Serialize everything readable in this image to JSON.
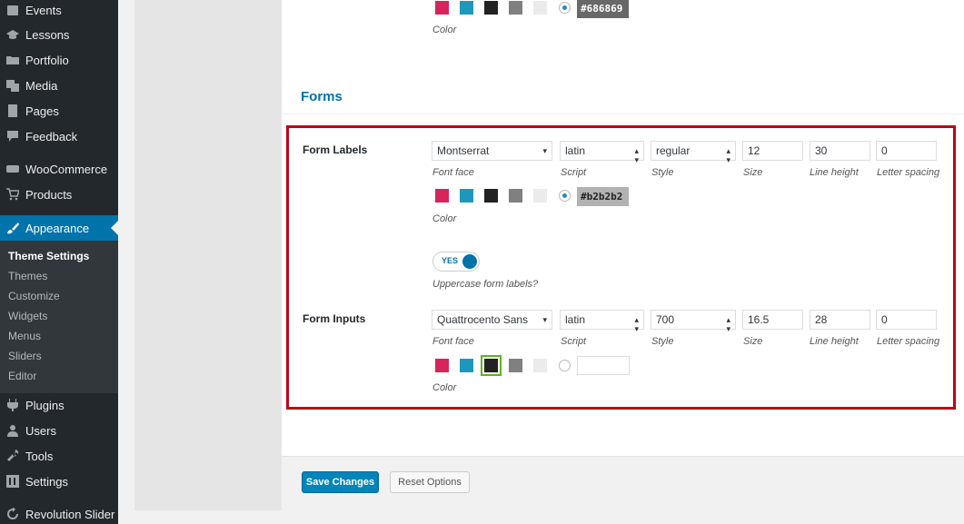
{
  "sidebar": {
    "items": [
      {
        "label": "Events",
        "icon": "calendar-icon"
      },
      {
        "label": "Lessons",
        "icon": "graduation-cap-icon"
      },
      {
        "label": "Portfolio",
        "icon": "folder-icon"
      },
      {
        "label": "Media",
        "icon": "media-icon"
      },
      {
        "label": "Pages",
        "icon": "page-icon"
      },
      {
        "label": "Feedback",
        "icon": "comment-icon"
      },
      {
        "label": "WooCommerce",
        "icon": "woocommerce-icon"
      },
      {
        "label": "Products",
        "icon": "cart-icon"
      },
      {
        "label": "Appearance",
        "icon": "paintbrush-icon"
      },
      {
        "label": "Plugins",
        "icon": "plugin-icon"
      },
      {
        "label": "Users",
        "icon": "user-icon"
      },
      {
        "label": "Tools",
        "icon": "wrench-icon"
      },
      {
        "label": "Settings",
        "icon": "settings-icon"
      },
      {
        "label": "Revolution Slider",
        "icon": "refresh-icon"
      }
    ],
    "submenu": [
      "Theme Settings",
      "Themes",
      "Customize",
      "Widgets",
      "Menus",
      "Sliders",
      "Editor"
    ]
  },
  "top_row": {
    "hex_value": "#686869",
    "color_label": "Color"
  },
  "section": {
    "title": "Forms"
  },
  "form_labels": {
    "label": "Form Labels",
    "font_face": "Montserrat",
    "script": "latin",
    "style": "regular",
    "size": "12",
    "line_height": "30",
    "letter_spacing": "0",
    "hex_value": "#b2b2b2",
    "toggle_text": "YES",
    "toggle_caption": "Uppercase form labels?"
  },
  "form_inputs": {
    "label": "Form Inputs",
    "font_face": "Quattrocento Sans",
    "script": "latin",
    "style": "700",
    "size": "16.5",
    "line_height": "28",
    "letter_spacing": "0",
    "hex_value": ""
  },
  "field_captions": {
    "font_face": "Font face",
    "script": "Script",
    "style": "Style",
    "size": "Size",
    "line_height": "Line height",
    "letter_spacing": "Letter spacing",
    "color": "Color"
  },
  "swatch_colors": [
    "#d6245d",
    "#1e97bd",
    "#222222",
    "#808080",
    "#ebebeb"
  ],
  "buttons": {
    "save": "Save Changes",
    "reset": "Reset Options"
  }
}
